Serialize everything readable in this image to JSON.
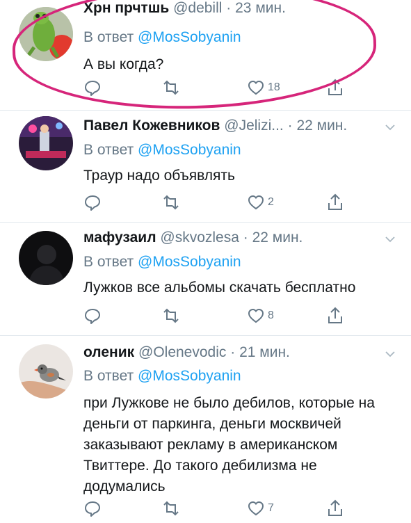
{
  "tweets": [
    {
      "name": "Хрн прчтшь",
      "handle": "@debill",
      "sep": "·",
      "time": "23 мин.",
      "reply_prefix": "В ответ",
      "reply_to": "@MosSobyanin",
      "text": "А вы когда?",
      "likes": "18",
      "avatar_icon": "frog-avatar"
    },
    {
      "name": "Павел Кожевников",
      "handle": "@Jelizi...",
      "sep": "·",
      "time": "22 мин.",
      "reply_prefix": "В ответ",
      "reply_to": "@MosSobyanin",
      "text": "Траур надо объявлять",
      "likes": "2",
      "avatar_icon": "stage-avatar"
    },
    {
      "name": "мафузаил",
      "handle": "@skvozlesa",
      "sep": "·",
      "time": "22 мин.",
      "reply_prefix": "В ответ",
      "reply_to": "@MosSobyanin",
      "text": "Лужков все альбомы скачать бесплатно",
      "likes": "8",
      "avatar_icon": "dark-silhouette-avatar"
    },
    {
      "name": "оленик",
      "handle": "@Olenevodic",
      "sep": "·",
      "time": "21 мин.",
      "reply_prefix": "В ответ",
      "reply_to": "@MosSobyanin",
      "text": "при Лужкове не было дебилов, которые на деньги от паркинга, деньги москвичей заказывают рекламу в американском Твиттере. До такого дебилизма не додумались",
      "likes": "7",
      "avatar_icon": "bird-on-hand-avatar"
    }
  ],
  "colors": {
    "accent": "#1da1f2",
    "secondary_text": "#657786",
    "primary_text": "#14171a",
    "highlight_circle": "#d6257a",
    "divider": "#e1e8ed"
  }
}
